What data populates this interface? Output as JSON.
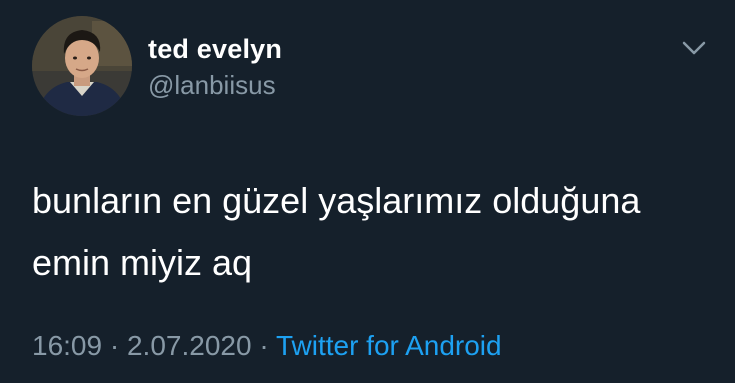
{
  "user": {
    "display_name": "ted evelyn",
    "handle": "@lanbiisus"
  },
  "tweet": {
    "line1": "bunların en güzel yaşlarımız olduğuna",
    "line2": "emin miyiz aq"
  },
  "meta": {
    "time": "16:09",
    "separator": "·",
    "date": "2.07.2020",
    "source": "Twitter for Android"
  },
  "colors": {
    "background": "#15202b",
    "secondary_text": "#8899a6",
    "link": "#1da1f2"
  },
  "icons": {
    "menu": "chevron-down-icon"
  }
}
